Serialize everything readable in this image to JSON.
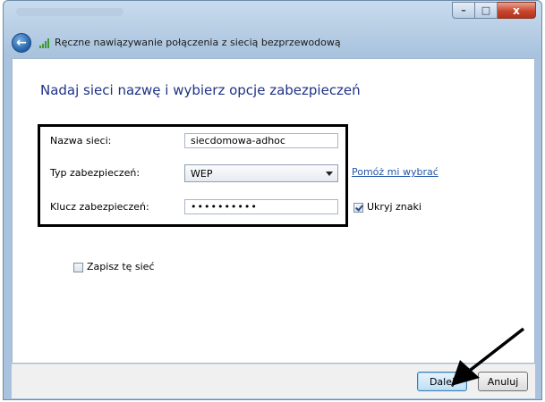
{
  "window": {
    "controls": {
      "minimize": "–",
      "maximize": "□",
      "close": "x"
    }
  },
  "nav": {
    "back_icon": "back-arrow-icon",
    "signal_icon": "wireless-signal-icon",
    "title": "Ręczne nawiązywanie połączenia z siecią bezprzewodową"
  },
  "main": {
    "heading": "Nadaj sieci nazwę i wybierz opcje zabezpieczeń",
    "network_name": {
      "label": "Nazwa sieci:",
      "value": "siecdomowa-adhoc"
    },
    "security_type": {
      "label": "Typ zabezpieczeń:",
      "value": "WEP",
      "help_link": "Pomóż mi wybrać"
    },
    "security_key": {
      "label": "Klucz zabezpieczeń:",
      "value": "••••••••••",
      "hide_chars_label": "Ukryj znaki",
      "hide_chars_checked": true
    },
    "save_network": {
      "label": "Zapisz tę sieć",
      "checked": false
    }
  },
  "footer": {
    "next_label": "Dalej",
    "cancel_label": "Anuluj"
  },
  "colors": {
    "heading": "#1e3287",
    "link": "#2356a8",
    "highlight_border": "#000000"
  }
}
